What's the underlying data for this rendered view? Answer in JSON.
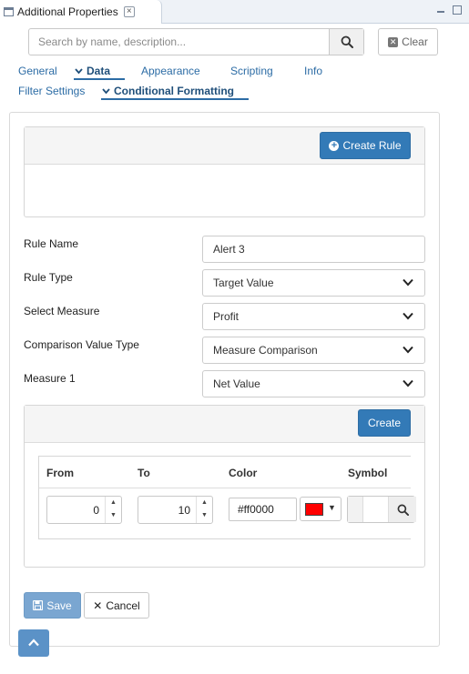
{
  "view": {
    "title": "Additional Properties",
    "close_glyph": "×",
    "icon": "properties-view-icon"
  },
  "search": {
    "placeholder": "Search by name, description...",
    "value": "",
    "clear_label": "Clear"
  },
  "tabs": [
    {
      "label": "General",
      "active": false
    },
    {
      "label": "Data",
      "active": true
    },
    {
      "label": "Appearance",
      "active": false
    },
    {
      "label": "Scripting",
      "active": false
    },
    {
      "label": "Info",
      "active": false
    }
  ],
  "subtabs": [
    {
      "label": "Filter Settings",
      "active": false
    },
    {
      "label": "Conditional Formatting",
      "active": true
    }
  ],
  "rules": {
    "create_rule_label": "Create Rule"
  },
  "form": {
    "rule_name": {
      "label": "Rule Name",
      "value": "Alert 3"
    },
    "rule_type": {
      "label": "Rule Type",
      "value": "Target Value"
    },
    "select_measure": {
      "label": "Select Measure",
      "value": "Profit"
    },
    "comparison_value_type": {
      "label": "Comparison Value Type",
      "value": "Measure Comparison"
    },
    "measure_1": {
      "label": "Measure 1",
      "value": "Net Value"
    }
  },
  "ranges": {
    "create_label": "Create",
    "columns": [
      "From",
      "To",
      "Color",
      "Symbol"
    ],
    "rows": [
      {
        "from": "0",
        "to": "10",
        "color": "#ff0000"
      }
    ]
  },
  "actions": {
    "save_label": "Save",
    "cancel_label": "Cancel"
  },
  "colors": {
    "primary": "#337ab7",
    "link": "#2c6ca5",
    "swatch": "#ff0000",
    "save_disabled": "#7aa6d1"
  }
}
